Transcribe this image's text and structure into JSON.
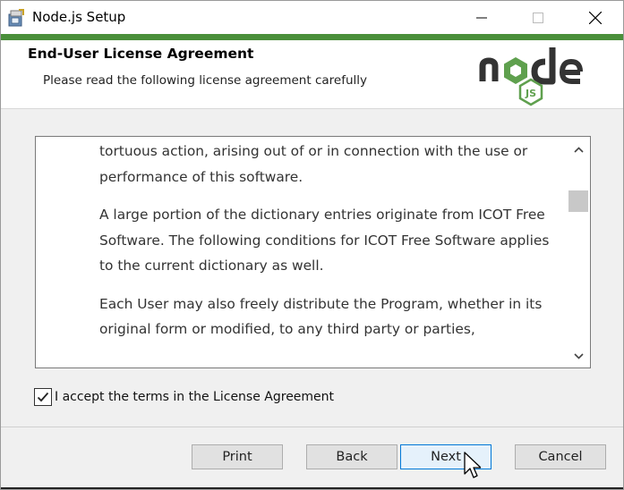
{
  "window": {
    "title": "Node.js Setup"
  },
  "banner": {
    "title": "End-User License Agreement",
    "subtitle": "Please read the following license agreement carefully",
    "logo_text": "node",
    "logo_badge": "JS"
  },
  "license": {
    "paragraphs": [
      "tortuous action, arising out of or in connection with the use or performance of this software.",
      "A large portion of the dictionary entries originate from ICOT Free Software. The following conditions for ICOT Free Software applies to the current dictionary as well.",
      "Each User may also freely distribute the Program, whether in its original form or modified, to any third party or parties,"
    ]
  },
  "accept": {
    "label": "I accept the terms in the License Agreement",
    "checked": true
  },
  "buttons": {
    "print": "Print",
    "back": "Back",
    "next": "Next",
    "cancel": "Cancel"
  },
  "colors": {
    "accent_green": "#4a8f3a",
    "focus_blue": "#0078d7",
    "logo_dark": "#333333",
    "logo_green": "#5fa04e"
  }
}
